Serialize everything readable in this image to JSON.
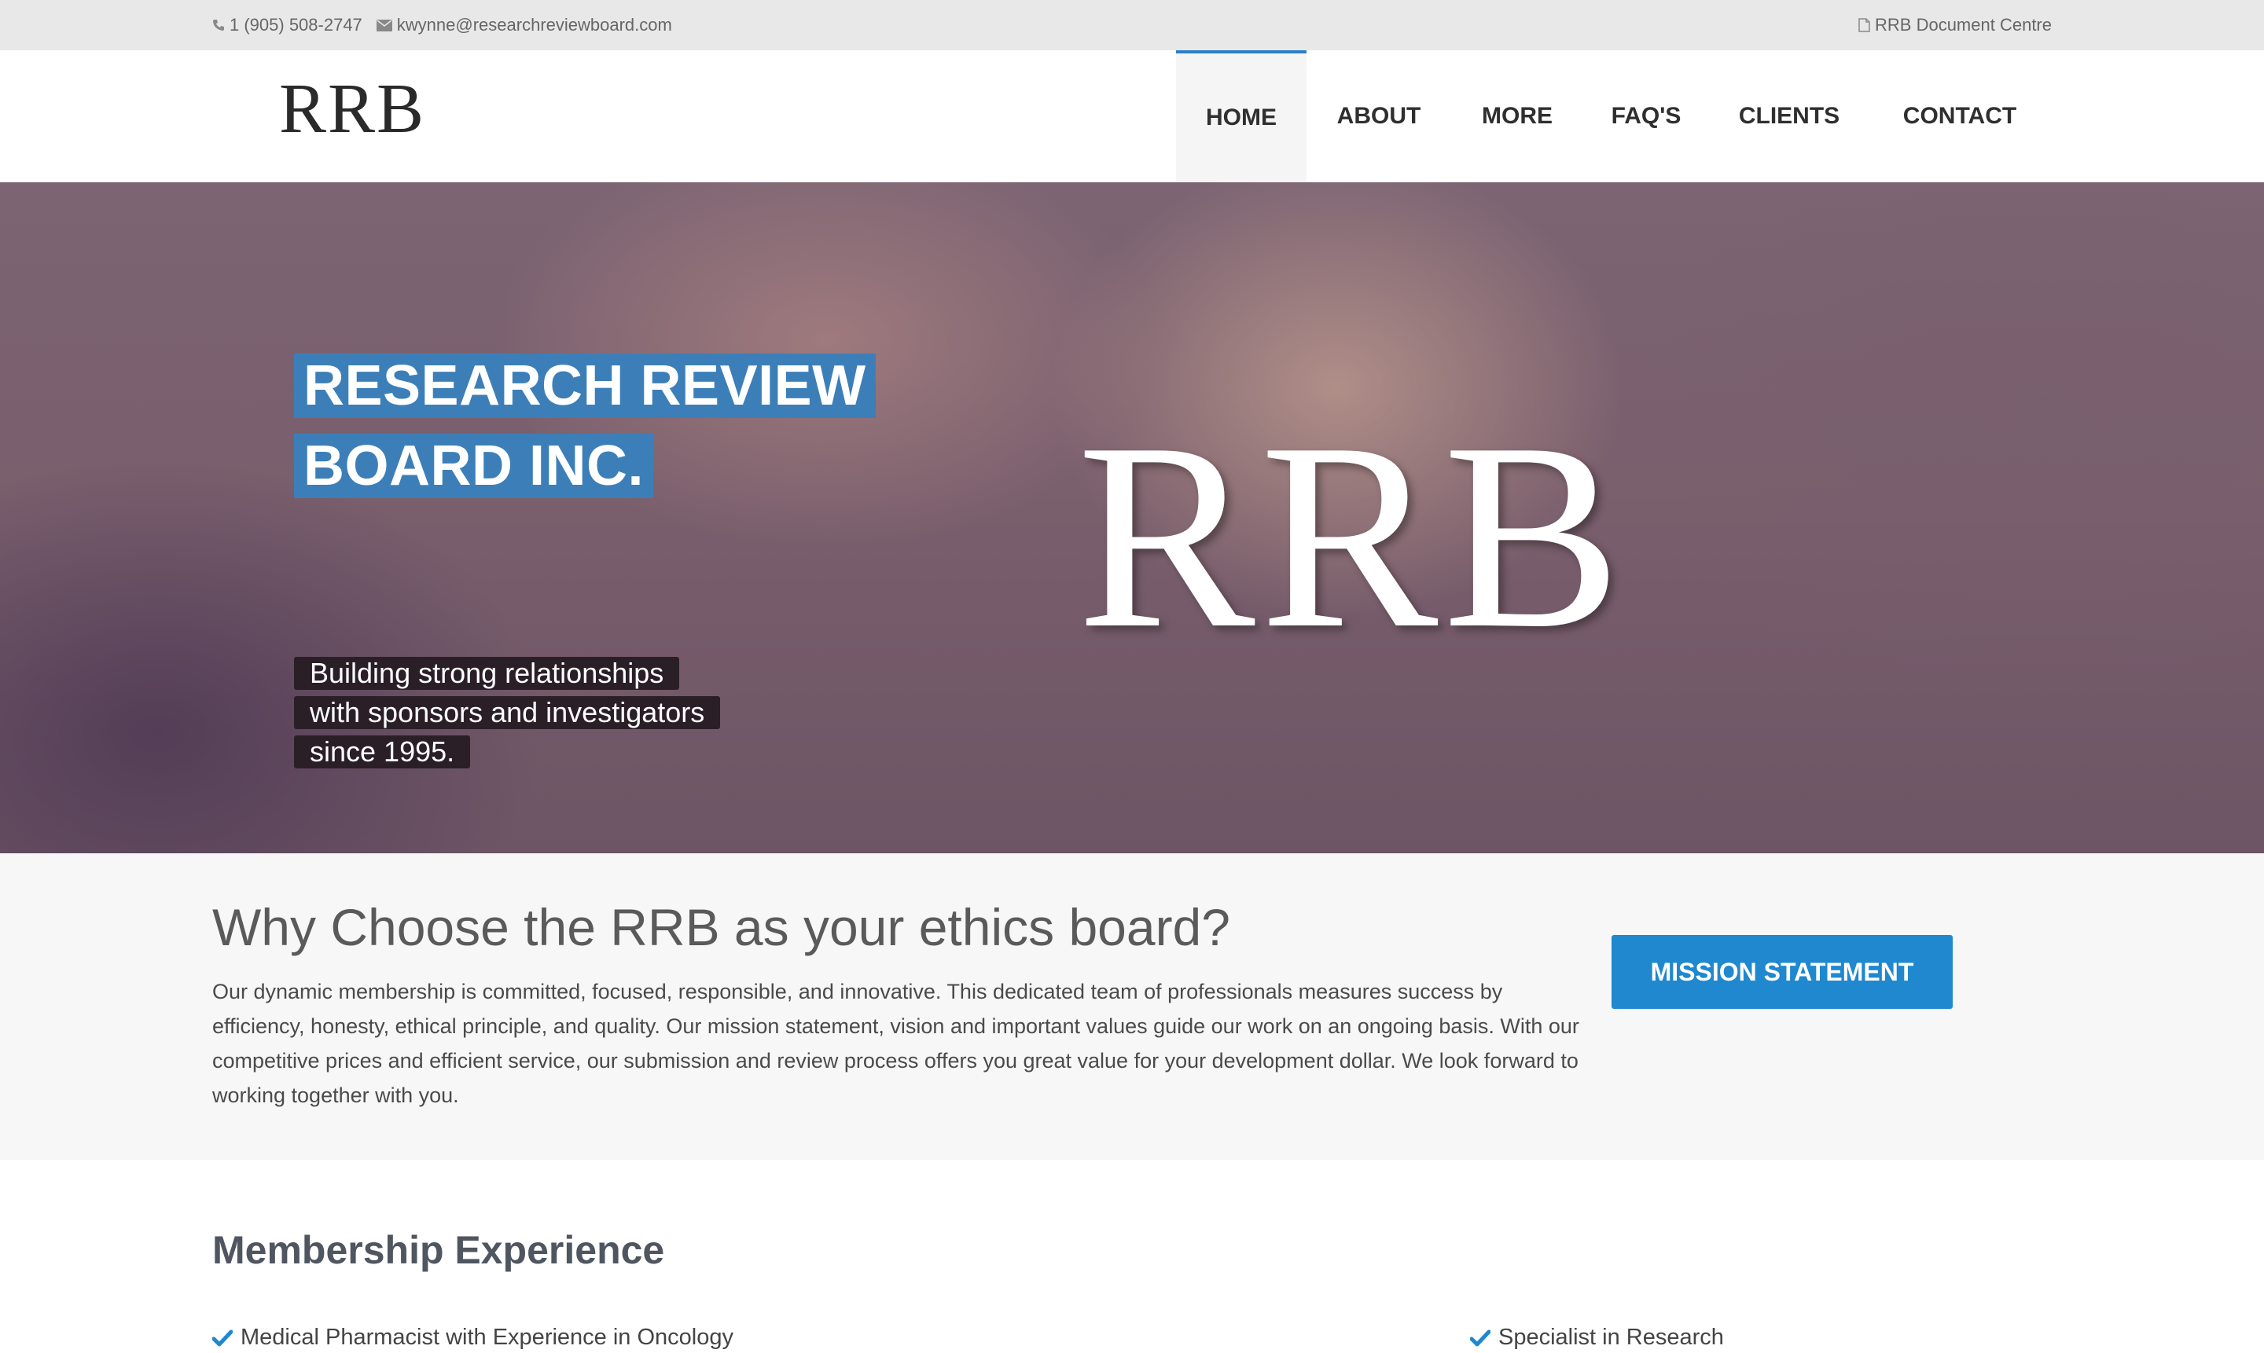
{
  "topbar": {
    "phone": "1 (905) 508-2747",
    "email": "kwynne@researchreviewboard.com",
    "document_centre": "RRB Document Centre"
  },
  "header": {
    "logo": "RRB",
    "nav": [
      {
        "label": "HOME",
        "active": true
      },
      {
        "label": "ABOUT",
        "active": false
      },
      {
        "label": "MORE",
        "active": false
      },
      {
        "label": "FAQ'S",
        "active": false
      },
      {
        "label": "CLIENTS",
        "active": false
      },
      {
        "label": "CONTACT",
        "active": false
      }
    ]
  },
  "hero": {
    "title_lines": [
      "RESEARCH REVIEW",
      "BOARD INC."
    ],
    "tagline_lines": [
      "Building strong relationships",
      "with sponsors and investigators",
      "since 1995."
    ],
    "brand": "RRB",
    "slides": 3,
    "active_slide": 1
  },
  "why": {
    "heading": "Why Choose the RRB as your ethics board?",
    "body": "Our dynamic membership is committed, focused, responsible, and innovative. This dedicated team of professionals measures success by efficiency, honesty, ethical principle, and quality. Our mission statement, vision and important values guide our work on an ongoing basis. With our competitive prices and efficient service, our submission and review process offers you great value for your development dollar. We look forward to working together with you.",
    "button": "MISSION STATEMENT"
  },
  "membership": {
    "heading": "Membership Experience",
    "items": [
      "Medical Pharmacist with Experience in Oncology",
      "Specialist in Research"
    ]
  },
  "colors": {
    "accent": "#1f88cf",
    "hero_title_bg": "#3c7fb8",
    "tagline_bg": "#2a1f27",
    "topbar_bg": "#e8e8e8"
  }
}
